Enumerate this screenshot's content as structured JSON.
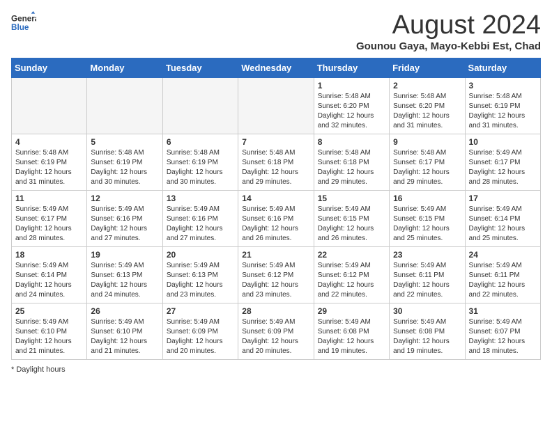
{
  "logo": {
    "line1": "General",
    "line2": "Blue"
  },
  "title": "August 2024",
  "subtitle": "Gounou Gaya, Mayo-Kebbi Est, Chad",
  "days_of_week": [
    "Sunday",
    "Monday",
    "Tuesday",
    "Wednesday",
    "Thursday",
    "Friday",
    "Saturday"
  ],
  "footer": "Daylight hours",
  "weeks": [
    [
      {
        "day": "",
        "info": "",
        "empty": true
      },
      {
        "day": "",
        "info": "",
        "empty": true
      },
      {
        "day": "",
        "info": "",
        "empty": true
      },
      {
        "day": "",
        "info": "",
        "empty": true
      },
      {
        "day": "1",
        "info": "Sunrise: 5:48 AM\nSunset: 6:20 PM\nDaylight: 12 hours\nand 32 minutes."
      },
      {
        "day": "2",
        "info": "Sunrise: 5:48 AM\nSunset: 6:20 PM\nDaylight: 12 hours\nand 31 minutes."
      },
      {
        "day": "3",
        "info": "Sunrise: 5:48 AM\nSunset: 6:19 PM\nDaylight: 12 hours\nand 31 minutes."
      }
    ],
    [
      {
        "day": "4",
        "info": "Sunrise: 5:48 AM\nSunset: 6:19 PM\nDaylight: 12 hours\nand 31 minutes."
      },
      {
        "day": "5",
        "info": "Sunrise: 5:48 AM\nSunset: 6:19 PM\nDaylight: 12 hours\nand 30 minutes."
      },
      {
        "day": "6",
        "info": "Sunrise: 5:48 AM\nSunset: 6:19 PM\nDaylight: 12 hours\nand 30 minutes."
      },
      {
        "day": "7",
        "info": "Sunrise: 5:48 AM\nSunset: 6:18 PM\nDaylight: 12 hours\nand 29 minutes."
      },
      {
        "day": "8",
        "info": "Sunrise: 5:48 AM\nSunset: 6:18 PM\nDaylight: 12 hours\nand 29 minutes."
      },
      {
        "day": "9",
        "info": "Sunrise: 5:48 AM\nSunset: 6:17 PM\nDaylight: 12 hours\nand 29 minutes."
      },
      {
        "day": "10",
        "info": "Sunrise: 5:49 AM\nSunset: 6:17 PM\nDaylight: 12 hours\nand 28 minutes."
      }
    ],
    [
      {
        "day": "11",
        "info": "Sunrise: 5:49 AM\nSunset: 6:17 PM\nDaylight: 12 hours\nand 28 minutes."
      },
      {
        "day": "12",
        "info": "Sunrise: 5:49 AM\nSunset: 6:16 PM\nDaylight: 12 hours\nand 27 minutes."
      },
      {
        "day": "13",
        "info": "Sunrise: 5:49 AM\nSunset: 6:16 PM\nDaylight: 12 hours\nand 27 minutes."
      },
      {
        "day": "14",
        "info": "Sunrise: 5:49 AM\nSunset: 6:16 PM\nDaylight: 12 hours\nand 26 minutes."
      },
      {
        "day": "15",
        "info": "Sunrise: 5:49 AM\nSunset: 6:15 PM\nDaylight: 12 hours\nand 26 minutes."
      },
      {
        "day": "16",
        "info": "Sunrise: 5:49 AM\nSunset: 6:15 PM\nDaylight: 12 hours\nand 25 minutes."
      },
      {
        "day": "17",
        "info": "Sunrise: 5:49 AM\nSunset: 6:14 PM\nDaylight: 12 hours\nand 25 minutes."
      }
    ],
    [
      {
        "day": "18",
        "info": "Sunrise: 5:49 AM\nSunset: 6:14 PM\nDaylight: 12 hours\nand 24 minutes."
      },
      {
        "day": "19",
        "info": "Sunrise: 5:49 AM\nSunset: 6:13 PM\nDaylight: 12 hours\nand 24 minutes."
      },
      {
        "day": "20",
        "info": "Sunrise: 5:49 AM\nSunset: 6:13 PM\nDaylight: 12 hours\nand 23 minutes."
      },
      {
        "day": "21",
        "info": "Sunrise: 5:49 AM\nSunset: 6:12 PM\nDaylight: 12 hours\nand 23 minutes."
      },
      {
        "day": "22",
        "info": "Sunrise: 5:49 AM\nSunset: 6:12 PM\nDaylight: 12 hours\nand 22 minutes."
      },
      {
        "day": "23",
        "info": "Sunrise: 5:49 AM\nSunset: 6:11 PM\nDaylight: 12 hours\nand 22 minutes."
      },
      {
        "day": "24",
        "info": "Sunrise: 5:49 AM\nSunset: 6:11 PM\nDaylight: 12 hours\nand 22 minutes."
      }
    ],
    [
      {
        "day": "25",
        "info": "Sunrise: 5:49 AM\nSunset: 6:10 PM\nDaylight: 12 hours\nand 21 minutes."
      },
      {
        "day": "26",
        "info": "Sunrise: 5:49 AM\nSunset: 6:10 PM\nDaylight: 12 hours\nand 21 minutes."
      },
      {
        "day": "27",
        "info": "Sunrise: 5:49 AM\nSunset: 6:09 PM\nDaylight: 12 hours\nand 20 minutes."
      },
      {
        "day": "28",
        "info": "Sunrise: 5:49 AM\nSunset: 6:09 PM\nDaylight: 12 hours\nand 20 minutes."
      },
      {
        "day": "29",
        "info": "Sunrise: 5:49 AM\nSunset: 6:08 PM\nDaylight: 12 hours\nand 19 minutes."
      },
      {
        "day": "30",
        "info": "Sunrise: 5:49 AM\nSunset: 6:08 PM\nDaylight: 12 hours\nand 19 minutes."
      },
      {
        "day": "31",
        "info": "Sunrise: 5:49 AM\nSunset: 6:07 PM\nDaylight: 12 hours\nand 18 minutes."
      }
    ]
  ]
}
